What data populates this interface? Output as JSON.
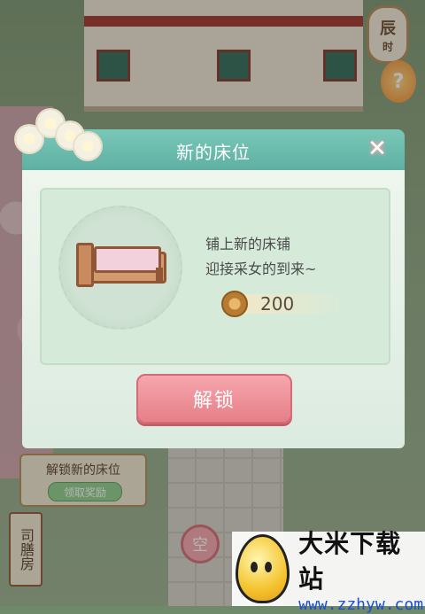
{
  "background": {
    "time_badge": {
      "main": "辰",
      "sub": "时"
    },
    "lantern_symbol": "?",
    "task": {
      "label": "解锁新的床位",
      "claim_label": "领取奖励"
    },
    "kitchen_sign": "司膳房",
    "empty_sign": "空"
  },
  "dialog": {
    "title": "新的床位",
    "close_icon": "close-icon",
    "description_line1": "铺上新的床铺",
    "description_line2": "迎接采女的到来~",
    "reward": {
      "icon": "coin-icon",
      "amount": "200"
    },
    "unlock_label": "解锁"
  },
  "watermark": {
    "title": "大米下载站",
    "url": "www.zzhyw.com"
  },
  "colors": {
    "dialog_header": "#6fbdae",
    "unlock_button": "#ec8f97",
    "panel_bg": "#e4f0e6"
  }
}
